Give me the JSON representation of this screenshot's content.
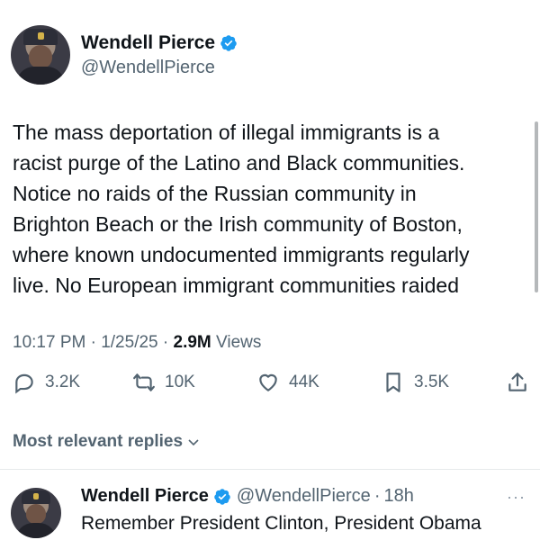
{
  "tweet": {
    "author": {
      "display_name": "Wendell Pierce",
      "handle": "@WendellPierce",
      "verified": true
    },
    "text_lines": [
      "The mass deportation of illegal immigrants is a",
      "racist purge of the Latino and Black communities.",
      "Notice no raids of the Russian community in",
      "Brighton Beach or the Irish community of Boston,",
      "where known undocumented immigrants regularly",
      "live. No European immigrant communities raided"
    ],
    "timestamp": "10:17 PM · 1/25/25 · ",
    "views_count": "2.9M",
    "views_label": " Views",
    "actions": {
      "reply_count": "3.2K",
      "retweet_count": "10K",
      "like_count": "44K",
      "bookmark_count": "3.5K"
    }
  },
  "replies_filter": {
    "label": "Most relevant replies"
  },
  "reply": {
    "display_name": "Wendell Pierce",
    "handle": "@WendellPierce",
    "separator": "·",
    "time": "18h",
    "more": "···",
    "text": "Remember President Clinton, President Obama"
  },
  "colors": {
    "verified_blue": "#1d9bf0",
    "secondary_text": "#536471",
    "primary_text": "#0f1419"
  }
}
